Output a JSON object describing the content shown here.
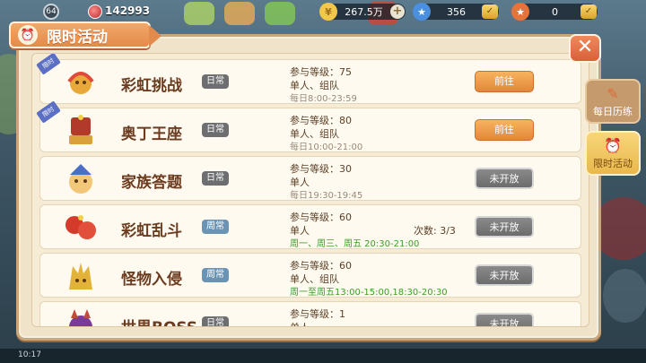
{
  "hud": {
    "level": "64",
    "power": "142993",
    "currencies": [
      {
        "name": "gold",
        "icon": "gold-coin-icon",
        "value": "267.5万"
      },
      {
        "name": "diamond",
        "icon": "star-ticket-icon",
        "value": "356"
      },
      {
        "name": "points",
        "icon": "star-badge-icon",
        "value": "0"
      }
    ]
  },
  "panel": {
    "title": "限时活动",
    "close_label": "✕"
  },
  "side_tabs": [
    {
      "label": "每日历练",
      "icon": "scroll-icon"
    },
    {
      "label": "限时活动",
      "icon": "clock-icon"
    }
  ],
  "activities": [
    {
      "name": "彩虹挑战",
      "type": "日常",
      "level_label": "参与等级：",
      "level": "75",
      "mode": "单人、组队",
      "time": "每日8:00-23:59",
      "time_highlight": false,
      "count": "",
      "button": "前往",
      "button_state": "go",
      "icon": "rainbow-challenge-icon",
      "tag": true
    },
    {
      "name": "奥丁王座",
      "type": "日常",
      "level_label": "参与等级：",
      "level": "80",
      "mode": "单人、组队",
      "time": "每日10:00-21:00",
      "time_highlight": false,
      "count": "",
      "button": "前往",
      "button_state": "go",
      "icon": "throne-icon",
      "tag": true
    },
    {
      "name": "家族答题",
      "type": "日常",
      "level_label": "参与等级：",
      "level": "30",
      "mode": "单人",
      "time": "每日19:30-19:45",
      "time_highlight": false,
      "count": "",
      "button": "未开放",
      "button_state": "closed",
      "icon": "quiz-mascot-icon",
      "tag": false
    },
    {
      "name": "彩虹乱斗",
      "type": "周常",
      "level_label": "参与等级：",
      "level": "60",
      "mode": "单人",
      "time": "周一、周三、周五 20:30-21:00",
      "time_highlight": true,
      "count": "次数: 3/3",
      "button": "未开放",
      "button_state": "closed",
      "icon": "boxing-glove-icon",
      "tag": false
    },
    {
      "name": "怪物入侵",
      "type": "周常",
      "level_label": "参与等级：",
      "level": "60",
      "mode": "单人、组队",
      "time": "周一至周五13:00-15:00,18:30-20:30",
      "time_highlight": true,
      "count": "",
      "button": "未开放",
      "button_state": "closed",
      "icon": "monster-icon",
      "tag": false
    },
    {
      "name": "世界BOSS",
      "type": "日常",
      "level_label": "参与等级：",
      "level": "1",
      "mode": "单人",
      "time": "",
      "time_highlight": false,
      "count": "",
      "button": "未开放",
      "button_state": "closed",
      "icon": "boss-icon",
      "tag": false
    }
  ],
  "status": {
    "clock": "10:17"
  }
}
